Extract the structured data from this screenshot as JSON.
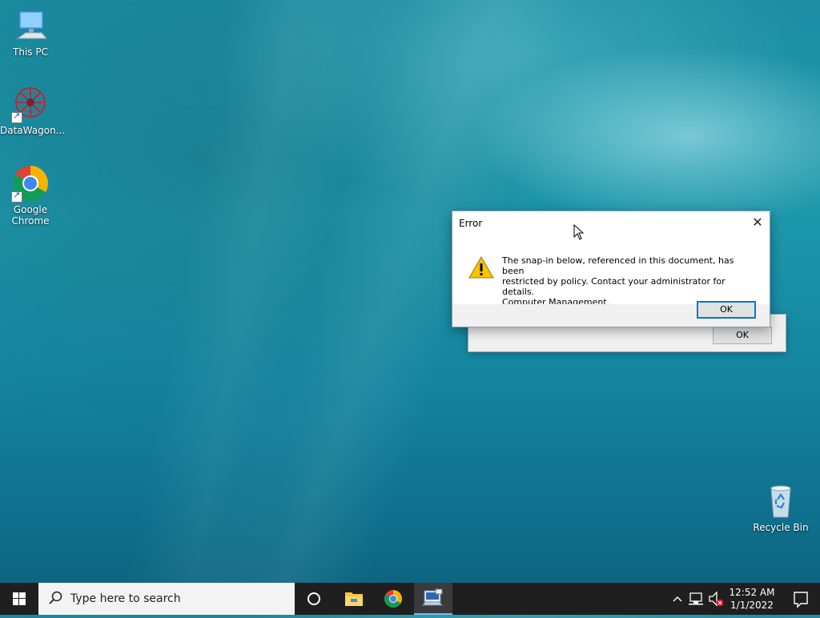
{
  "desktop": {
    "icons": [
      {
        "label": "This PC",
        "icon": "computer-icon"
      },
      {
        "label": "DataWagon...",
        "icon": "datawagon-icon"
      },
      {
        "label": "Google Chrome",
        "icon": "chrome-icon"
      },
      {
        "label": "Recycle Bin",
        "icon": "recycle-bin-icon"
      }
    ]
  },
  "dialog": {
    "title": "Error",
    "message_lines": [
      "The snap-in below, referenced in this document, has been",
      "restricted by policy. Contact your administrator for details.",
      "Computer Management."
    ],
    "ok_label": "OK",
    "icon": "warning-icon"
  },
  "dialog_behind": {
    "ok_label": "OK"
  },
  "taskbar": {
    "search_placeholder": "Type here to search",
    "pinned": [
      "cortana-icon",
      "file-explorer-icon",
      "chrome-icon",
      "mmc-icon"
    ],
    "clock": {
      "time": "12:52 AM",
      "date": "1/1/2022"
    }
  }
}
